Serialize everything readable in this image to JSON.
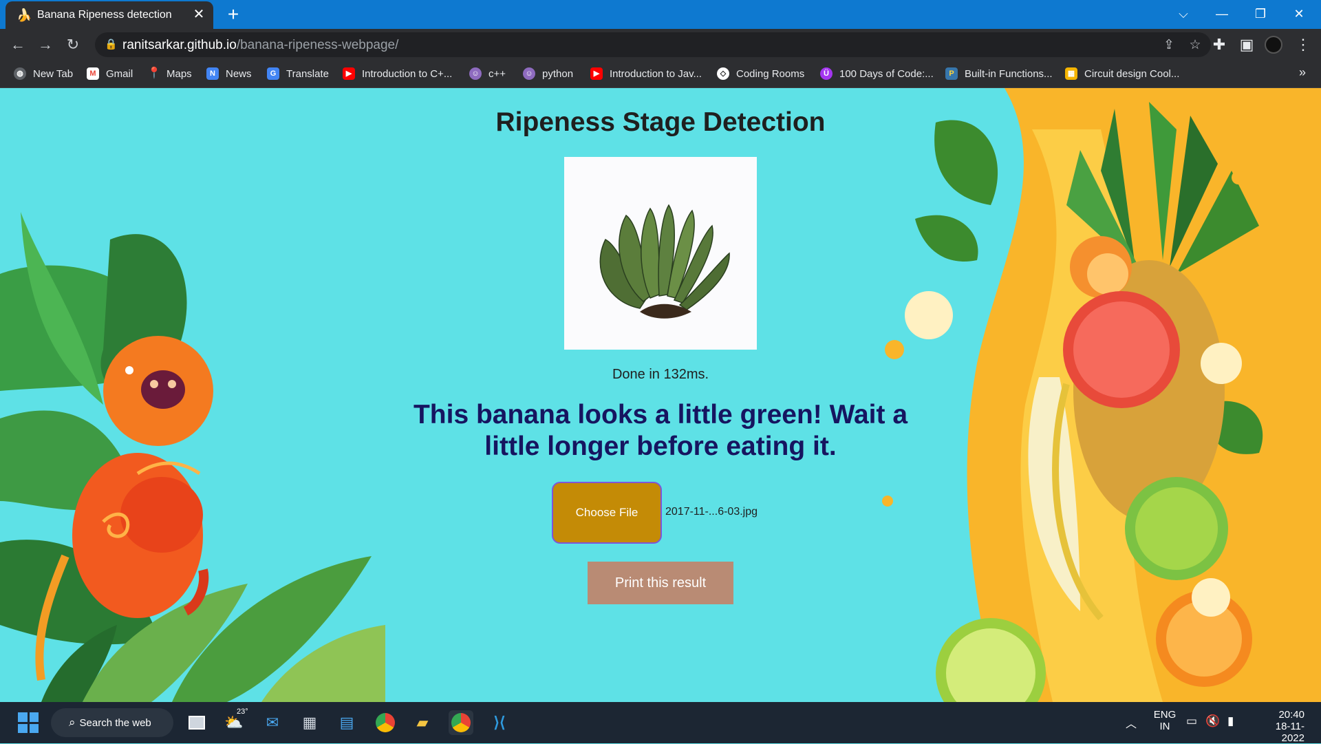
{
  "browser": {
    "tab": {
      "title": "Banana Ripeness detection",
      "favicon": "banana-icon",
      "close": "✕"
    },
    "new_tab": "+",
    "window_controls": [
      "⌵",
      "—",
      "❐",
      "✕"
    ],
    "url_host": "ranitsarkar.github.io",
    "url_path": "/banana-ripeness-webpage/"
  },
  "bookmarks": {
    "items": [
      {
        "label": "New Tab",
        "icon": "globe-icon",
        "color": "#5f6368"
      },
      {
        "label": "Gmail",
        "icon": "gmail-icon",
        "color": "#ea4335"
      },
      {
        "label": "Maps",
        "icon": "maps-icon",
        "color": "#34a853"
      },
      {
        "label": "News",
        "icon": "news-icon",
        "color": "#4285f4"
      },
      {
        "label": "Translate",
        "icon": "translate-icon",
        "color": "#4285f4"
      },
      {
        "label": "Introduction to C+...",
        "icon": "youtube-icon",
        "color": "#ff0000"
      },
      {
        "label": "c++",
        "icon": "avatar-icon",
        "color": "#8e6bbf"
      },
      {
        "label": "python",
        "icon": "avatar-icon",
        "color": "#8e6bbf"
      },
      {
        "label": "Introduction to Jav...",
        "icon": "youtube-icon",
        "color": "#ff0000"
      },
      {
        "label": "Coding Rooms",
        "icon": "coding-rooms-icon",
        "color": "#ffffff"
      },
      {
        "label": "100 Days of Code:...",
        "icon": "udemy-icon",
        "color": "#a435f0"
      },
      {
        "label": "Built-in Functions...",
        "icon": "python-icon",
        "color": "#3776ab"
      },
      {
        "label": "Circuit design Cool...",
        "icon": "circuit-icon",
        "color": "#f4b400"
      }
    ],
    "more": "»"
  },
  "page": {
    "title": "Ripeness Stage Detection",
    "status": "Done in 132ms.",
    "result": "This banana looks a little green! Wait a little longer before eating it.",
    "choose_file": "Choose File",
    "file_name": "2017-11-...6-03.jpg",
    "print_button": "Print this result"
  },
  "taskbar": {
    "search_label": "Search the web",
    "weather": "23°",
    "lang_top": "ENG",
    "lang_bottom": "IN",
    "time": "20:40",
    "date": "18-11-2022"
  },
  "colors": {
    "page_bg": "#5ee1e6",
    "result_text": "#161560",
    "choose_button": "#c48b06",
    "print_button": "#b98b74"
  }
}
